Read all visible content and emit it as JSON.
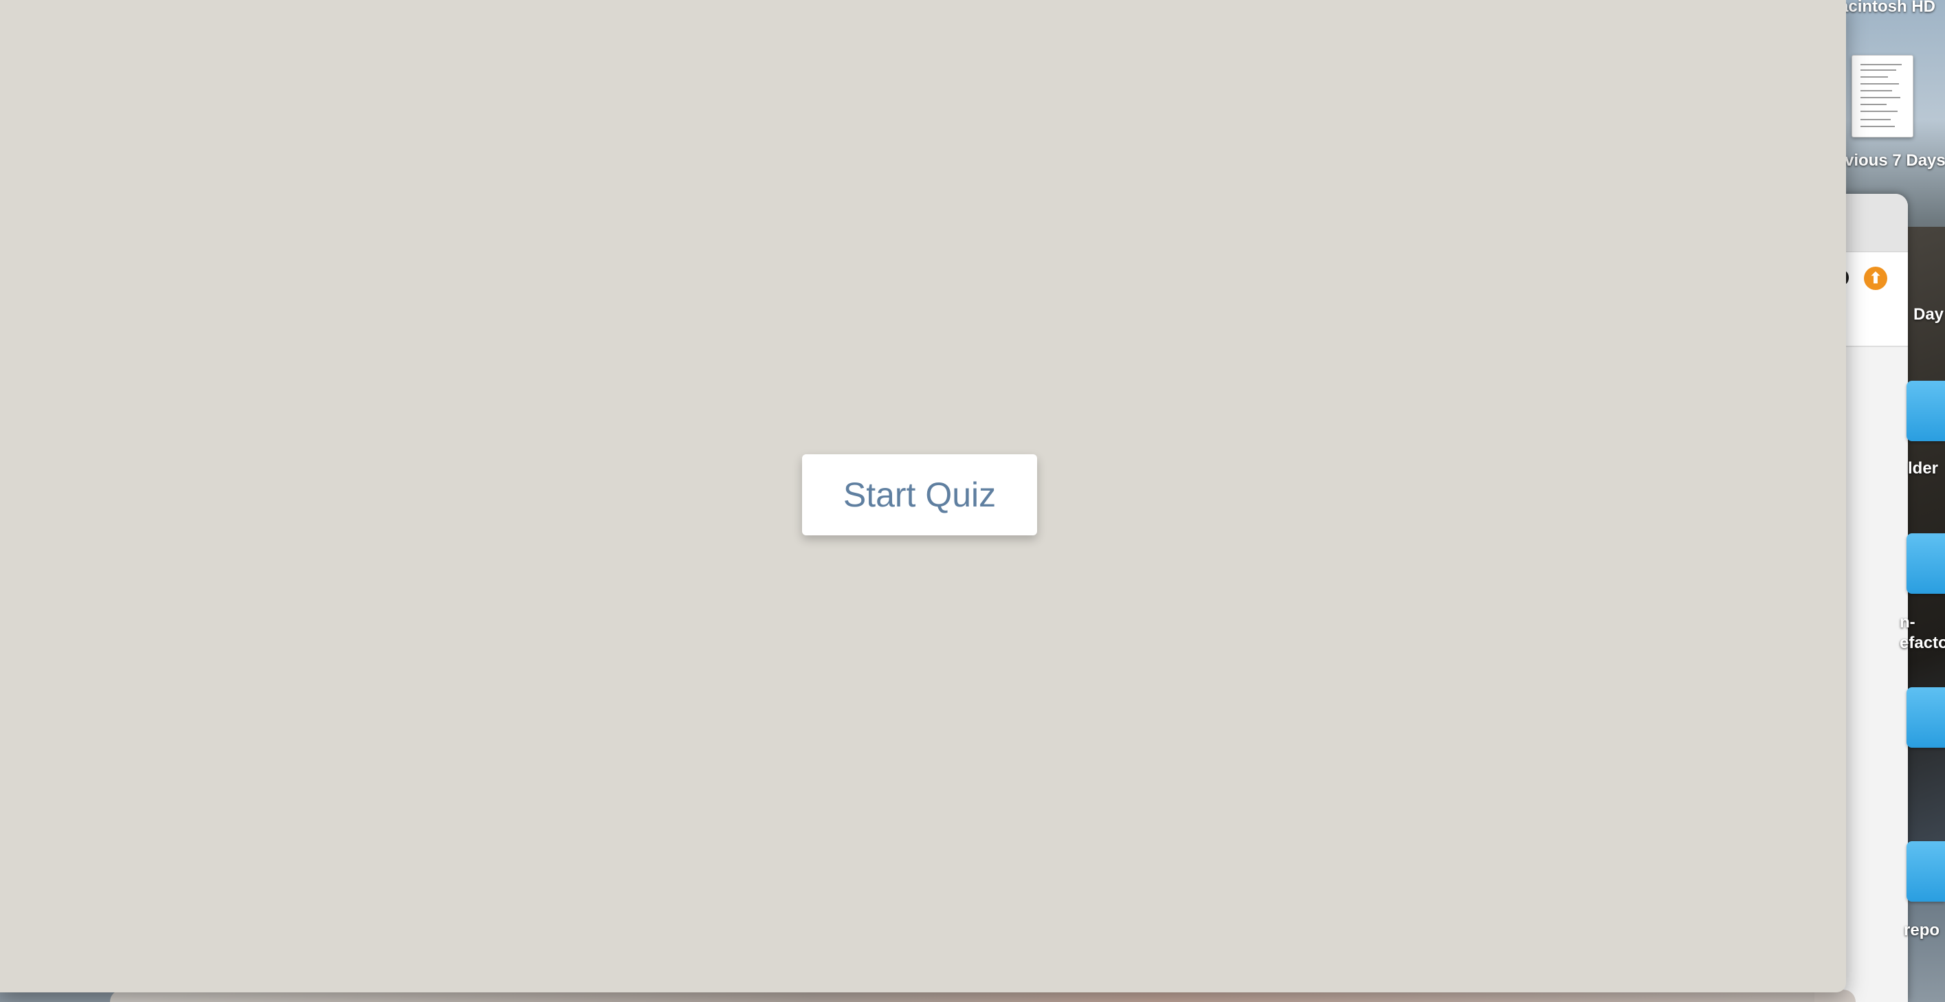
{
  "app": {
    "start_button_label": "Start Quiz"
  },
  "desktop": {
    "labels": {
      "drive": "acintosh HD",
      "recent_doc": "vious 7 Days",
      "partial_days": "Day",
      "folder_1": "lder",
      "folder_2_line1": "n-",
      "folder_2_line2": "efacto",
      "folder_3": "repo"
    },
    "upload_icon_glyph": "⬆"
  },
  "colors": {
    "window_background": "#dbd8d1",
    "button_text": "#5f7fa0",
    "button_background": "#ffffff",
    "upload_badge": "#f0921e",
    "folder_blue": "#2a9ee0"
  }
}
